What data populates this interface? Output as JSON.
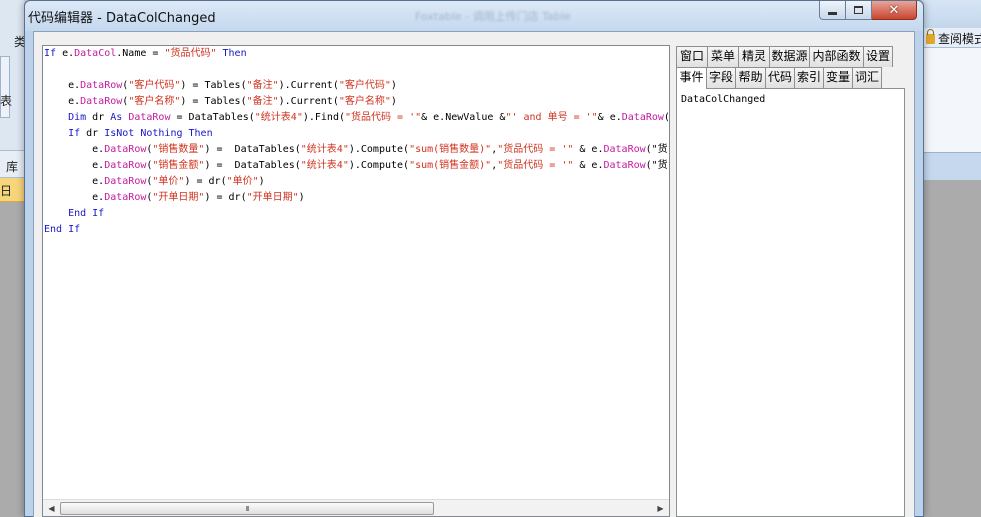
{
  "background": {
    "left_fragments": [
      "类",
      "表",
      "库",
      "日"
    ],
    "right_label": "查阅模式",
    "blurred_caption": "Foxtable - 调用上传门店 Table"
  },
  "window": {
    "title": "代码编辑器 - DataColChanged",
    "buttons": {
      "minimize": "minimize",
      "maximize": "maximize",
      "close": "✕"
    }
  },
  "editor": {
    "lines": [
      [
        {
          "t": "If",
          "c": "kw"
        },
        {
          "t": " e.",
          "c": ""
        },
        {
          "t": "DataCol",
          "c": "mb"
        },
        {
          "t": ".Name = ",
          "c": ""
        },
        {
          "t": "\"货品代码\"",
          "c": "st"
        },
        {
          "t": " Then",
          "c": "kw"
        }
      ],
      [],
      [
        {
          "t": "    e.",
          "c": ""
        },
        {
          "t": "DataRow",
          "c": "mb"
        },
        {
          "t": "(",
          "c": ""
        },
        {
          "t": "\"客户代码\"",
          "c": "st"
        },
        {
          "t": ") = Tables(",
          "c": ""
        },
        {
          "t": "\"备注\"",
          "c": "st"
        },
        {
          "t": ").Current(",
          "c": ""
        },
        {
          "t": "\"客户代码\"",
          "c": "st"
        },
        {
          "t": ")",
          "c": ""
        }
      ],
      [
        {
          "t": "    e.",
          "c": ""
        },
        {
          "t": "DataRow",
          "c": "mb"
        },
        {
          "t": "(",
          "c": ""
        },
        {
          "t": "\"客户名称\"",
          "c": "st"
        },
        {
          "t": ") = Tables(",
          "c": ""
        },
        {
          "t": "\"备注\"",
          "c": "st"
        },
        {
          "t": ").Current(",
          "c": ""
        },
        {
          "t": "\"客户名称\"",
          "c": "st"
        },
        {
          "t": ")",
          "c": ""
        }
      ],
      [
        {
          "t": "    Dim",
          "c": "kw"
        },
        {
          "t": " dr ",
          "c": ""
        },
        {
          "t": "As",
          "c": "kw"
        },
        {
          "t": " ",
          "c": ""
        },
        {
          "t": "DataRow",
          "c": "mb"
        },
        {
          "t": " = DataTables(",
          "c": ""
        },
        {
          "t": "\"统计表4\"",
          "c": "st"
        },
        {
          "t": ").Find(",
          "c": ""
        },
        {
          "t": "\"货品代码 = '\"",
          "c": "st"
        },
        {
          "t": "& e.NewValue &",
          "c": ""
        },
        {
          "t": "\"' and 单号 = '\"",
          "c": "st"
        },
        {
          "t": "& e.",
          "c": ""
        },
        {
          "t": "DataRow",
          "c": "mb"
        },
        {
          "t": "(\"单号\") & \"'\")",
          "c": ""
        }
      ],
      [
        {
          "t": "    If",
          "c": "kw"
        },
        {
          "t": " dr ",
          "c": ""
        },
        {
          "t": "IsNot Nothing Then",
          "c": "kw"
        }
      ],
      [
        {
          "t": "        e.",
          "c": ""
        },
        {
          "t": "DataRow",
          "c": "mb"
        },
        {
          "t": "(",
          "c": ""
        },
        {
          "t": "\"销售数量\"",
          "c": "st"
        },
        {
          "t": ") =  DataTables(",
          "c": ""
        },
        {
          "t": "\"统计表4\"",
          "c": "st"
        },
        {
          "t": ").Compute(",
          "c": ""
        },
        {
          "t": "\"sum(销售数量)\"",
          "c": "st"
        },
        {
          "t": ",",
          "c": ""
        },
        {
          "t": "\"货品代码 = '\"",
          "c": "st"
        },
        {
          "t": " & e.",
          "c": ""
        },
        {
          "t": "DataRow",
          "c": "mb"
        },
        {
          "t": "(\"货品代码\"))",
          "c": ""
        }
      ],
      [
        {
          "t": "        e.",
          "c": ""
        },
        {
          "t": "DataRow",
          "c": "mb"
        },
        {
          "t": "(",
          "c": ""
        },
        {
          "t": "\"销售金额\"",
          "c": "st"
        },
        {
          "t": ") =  DataTables(",
          "c": ""
        },
        {
          "t": "\"统计表4\"",
          "c": "st"
        },
        {
          "t": ").Compute(",
          "c": ""
        },
        {
          "t": "\"sum(销售金额)\"",
          "c": "st"
        },
        {
          "t": ",",
          "c": ""
        },
        {
          "t": "\"货品代码 = '\"",
          "c": "st"
        },
        {
          "t": " & e.",
          "c": ""
        },
        {
          "t": "DataRow",
          "c": "mb"
        },
        {
          "t": "(\"货品代码\"))",
          "c": ""
        }
      ],
      [
        {
          "t": "        e.",
          "c": ""
        },
        {
          "t": "DataRow",
          "c": "mb"
        },
        {
          "t": "(",
          "c": ""
        },
        {
          "t": "\"单价\"",
          "c": "st"
        },
        {
          "t": ") = dr(",
          "c": ""
        },
        {
          "t": "\"单价\"",
          "c": "st"
        },
        {
          "t": ")",
          "c": ""
        }
      ],
      [
        {
          "t": "        e.",
          "c": ""
        },
        {
          "t": "DataRow",
          "c": "mb"
        },
        {
          "t": "(",
          "c": ""
        },
        {
          "t": "\"开单日期\"",
          "c": "st"
        },
        {
          "t": ") = dr(",
          "c": ""
        },
        {
          "t": "\"开单日期\"",
          "c": "st"
        },
        {
          "t": ")",
          "c": ""
        }
      ],
      [
        {
          "t": "    End If",
          "c": "kw"
        }
      ],
      [
        {
          "t": "End If",
          "c": "kw"
        }
      ]
    ],
    "scroll_grip": "III",
    "colors": {
      "keyword": "#1818c8",
      "member": "#c41aa0",
      "string": "#d0321e"
    }
  },
  "panel": {
    "tabs_row1": [
      "窗口",
      "菜单",
      "精灵",
      "数据源",
      "内部函数",
      "设置"
    ],
    "tabs_row2": [
      "事件",
      "字段",
      "帮助",
      "代码",
      "索引",
      "变量",
      "词汇"
    ],
    "active_tab": "事件",
    "list_items": [
      "DataColChanged"
    ]
  }
}
